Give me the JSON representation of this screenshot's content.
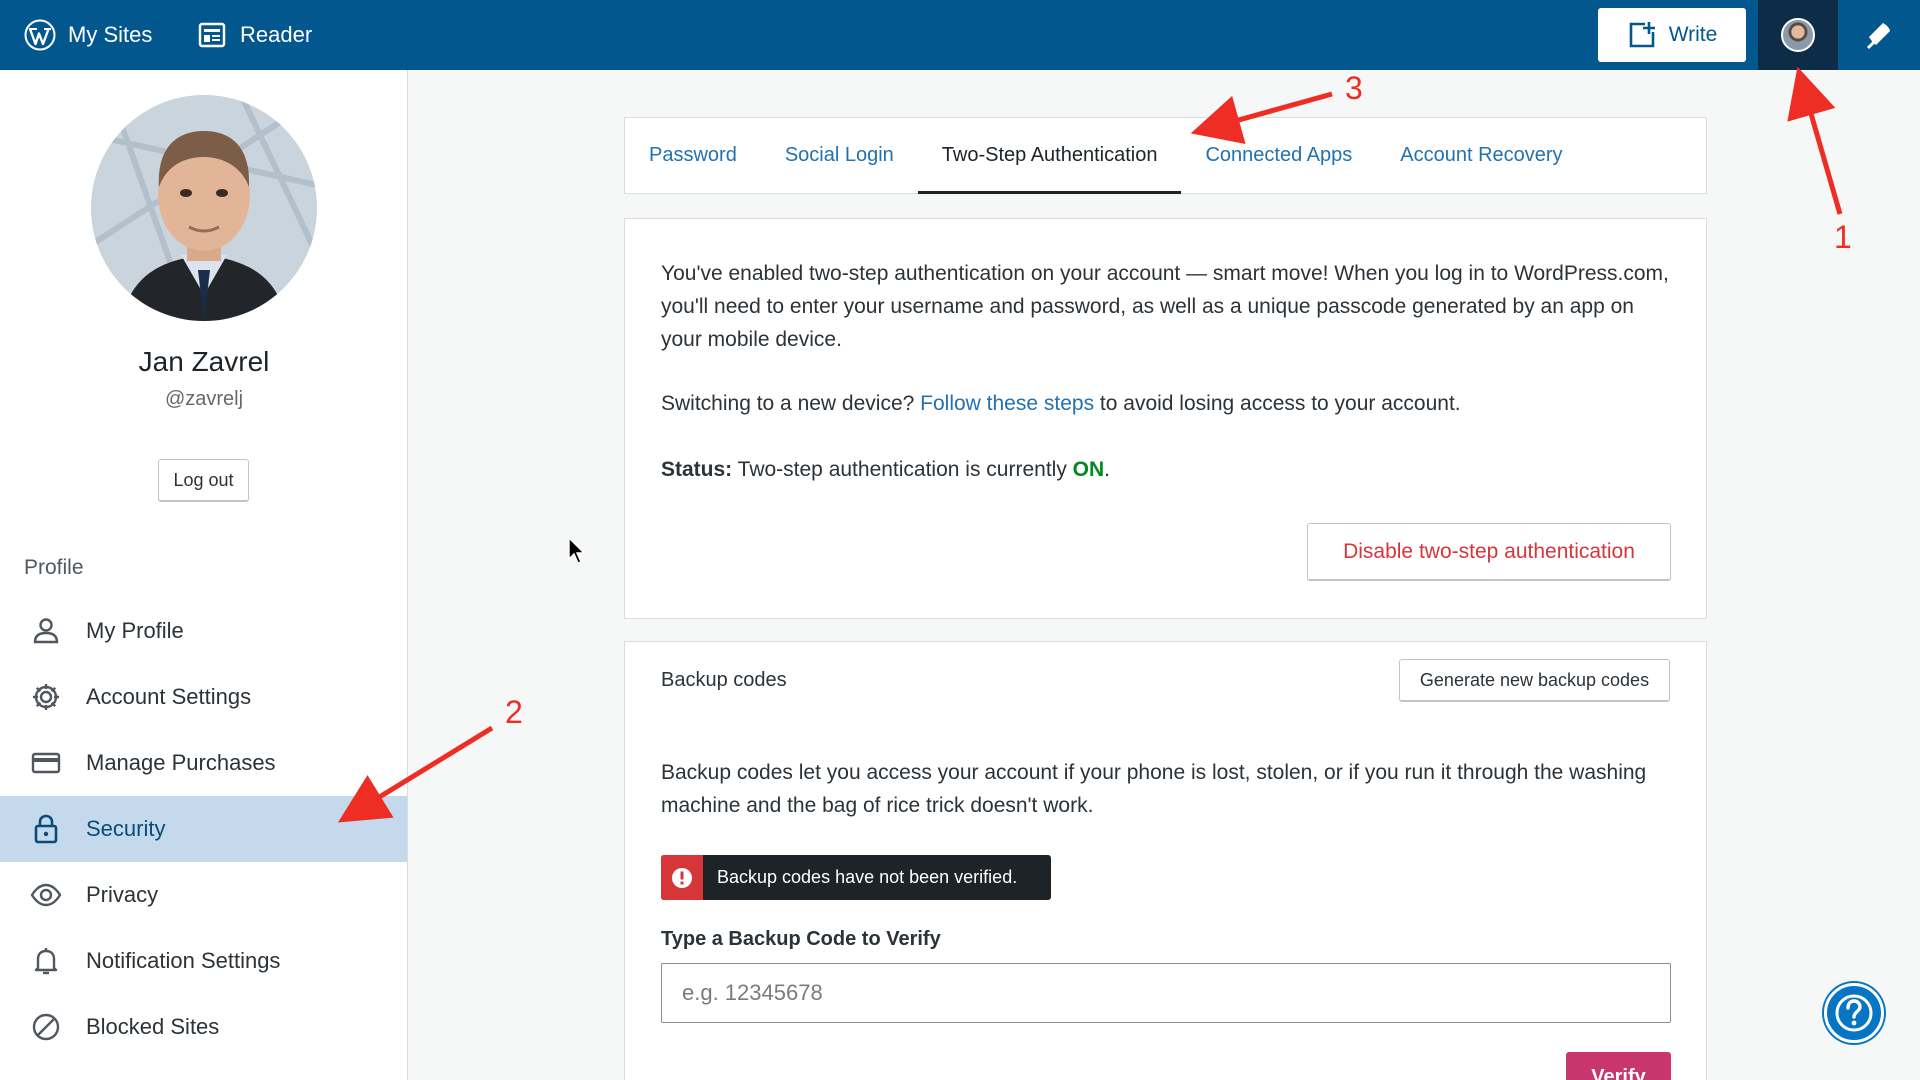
{
  "masterbar": {
    "my_sites_label": "My Sites",
    "reader_label": "Reader",
    "write_label": "Write",
    "brand_color": "#03578f"
  },
  "sidebar": {
    "user_name": "Jan Zavrel",
    "user_handle": "@zavrelj",
    "logout_label": "Log out",
    "section_heading": "Profile",
    "items": [
      {
        "label": "My Profile",
        "icon": "person-icon",
        "active": false
      },
      {
        "label": "Account Settings",
        "icon": "gear-icon",
        "active": false
      },
      {
        "label": "Manage Purchases",
        "icon": "credit-card-icon",
        "active": false
      },
      {
        "label": "Security",
        "icon": "lock-icon",
        "active": true
      },
      {
        "label": "Privacy",
        "icon": "eye-icon",
        "active": false
      },
      {
        "label": "Notification Settings",
        "icon": "bell-icon",
        "active": false
      },
      {
        "label": "Blocked Sites",
        "icon": "block-icon",
        "active": false
      }
    ]
  },
  "tabs": [
    {
      "label": "Password",
      "active": false
    },
    {
      "label": "Social Login",
      "active": false
    },
    {
      "label": "Two-Step Authentication",
      "active": true
    },
    {
      "label": "Connected Apps",
      "active": false
    },
    {
      "label": "Account Recovery",
      "active": false
    }
  ],
  "two_step": {
    "intro": "You've enabled two-step authentication on your account — smart move! When you log in to WordPress.com, you'll need to enter your username and password, as well as a unique passcode generated by an app on your mobile device.",
    "switch_prefix": "Switching to a new device?",
    "switch_link": "Follow these steps",
    "switch_suffix": "to avoid losing access to your account.",
    "status_label": "Status:",
    "status_text": "Two-step authentication is currently",
    "status_value": "ON",
    "status_end": ".",
    "disable_label": "Disable two-step authentication"
  },
  "backup": {
    "title": "Backup codes",
    "generate_label": "Generate new backup codes",
    "description": "Backup codes let you access your account if your phone is lost, stolen, or if you run it through the washing machine and the bag of rice trick doesn't work.",
    "notice": "Backup codes have not been verified.",
    "field_label": "Type a Backup Code to Verify",
    "field_placeholder": "e.g. 12345678",
    "field_value": "",
    "verify_label": "Verify"
  },
  "annotations": [
    "1",
    "2",
    "3"
  ],
  "colors": {
    "link": "#2271b1",
    "danger": "#d63638",
    "success": "#008a20",
    "active_item_bg": "#c5d9ed",
    "verify_bg": "#c9356e",
    "annotation": "#ee2d24"
  }
}
